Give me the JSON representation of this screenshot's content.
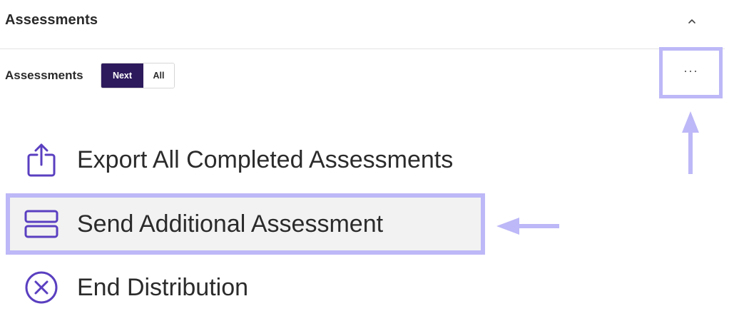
{
  "section": {
    "title": "Assessments",
    "collapse_icon": "chevron-up-icon"
  },
  "toolbar": {
    "label": "Assessments",
    "toggle": {
      "next_label": "Next",
      "all_label": "All",
      "selected": "Next"
    },
    "more_label": "···",
    "more_icon": "more-horizontal-icon"
  },
  "menu": {
    "items": [
      {
        "label": "Export All Completed Assessments",
        "icon": "share-upload-icon"
      },
      {
        "label": "Send Additional Assessment",
        "icon": "stacked-rectangles-icon",
        "highlighted": true
      },
      {
        "label": "End Distribution",
        "icon": "close-circle-icon"
      }
    ]
  },
  "colors": {
    "accent": "#2d1a5c",
    "highlight": "#bdb8f7",
    "icon": "#5a3fc0",
    "hover_bg": "#f2f2f2"
  }
}
